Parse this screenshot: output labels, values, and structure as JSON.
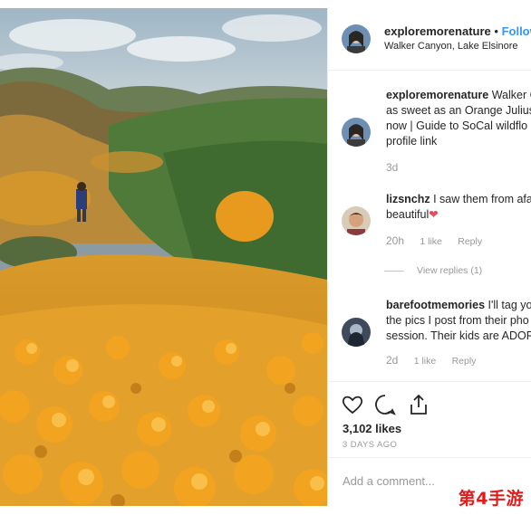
{
  "post": {
    "author": "exploremorenature",
    "follow_sep": "•",
    "follow_label": "Follow",
    "location": "Walker Canyon, Lake Elsinore"
  },
  "comments": [
    {
      "user": "exploremorenature",
      "text": "Walker C... as sweet as an Orange Julius now | Guide to SoCal wildflo... profile link",
      "line1": " Walker C",
      "line2": "as sweet as an Orange Julius",
      "line3": "now | Guide to SoCal wildflo",
      "line4": "profile link",
      "time": "3d"
    },
    {
      "user": "lizsnchz",
      "line1": " I saw them from afa",
      "line2": "beautiful",
      "emoji": "❤",
      "time": "20h",
      "likes": "1 like",
      "reply": "Reply",
      "view_replies": "View replies (1)"
    },
    {
      "user": "barefootmemories",
      "line1": " I'll tag yo",
      "line2": "the pics I post from their pho",
      "line3": "session. Their kids are ADOR",
      "time": "2d",
      "likes": "1 like",
      "reply": "Reply"
    }
  ],
  "actions": {
    "like_icon": "heart-icon",
    "comment_icon": "comment-icon",
    "share_icon": "share-icon",
    "likes_count": "3,102 likes",
    "posted_ago": "3 DAYS AGO"
  },
  "add_comment": {
    "placeholder": "Add a comment..."
  },
  "watermark": "第4手游",
  "colors": {
    "link_blue": "#3897f0",
    "muted": "#999999",
    "poppy_orange": "#f0a11e",
    "heart_red": "#ed4956"
  }
}
